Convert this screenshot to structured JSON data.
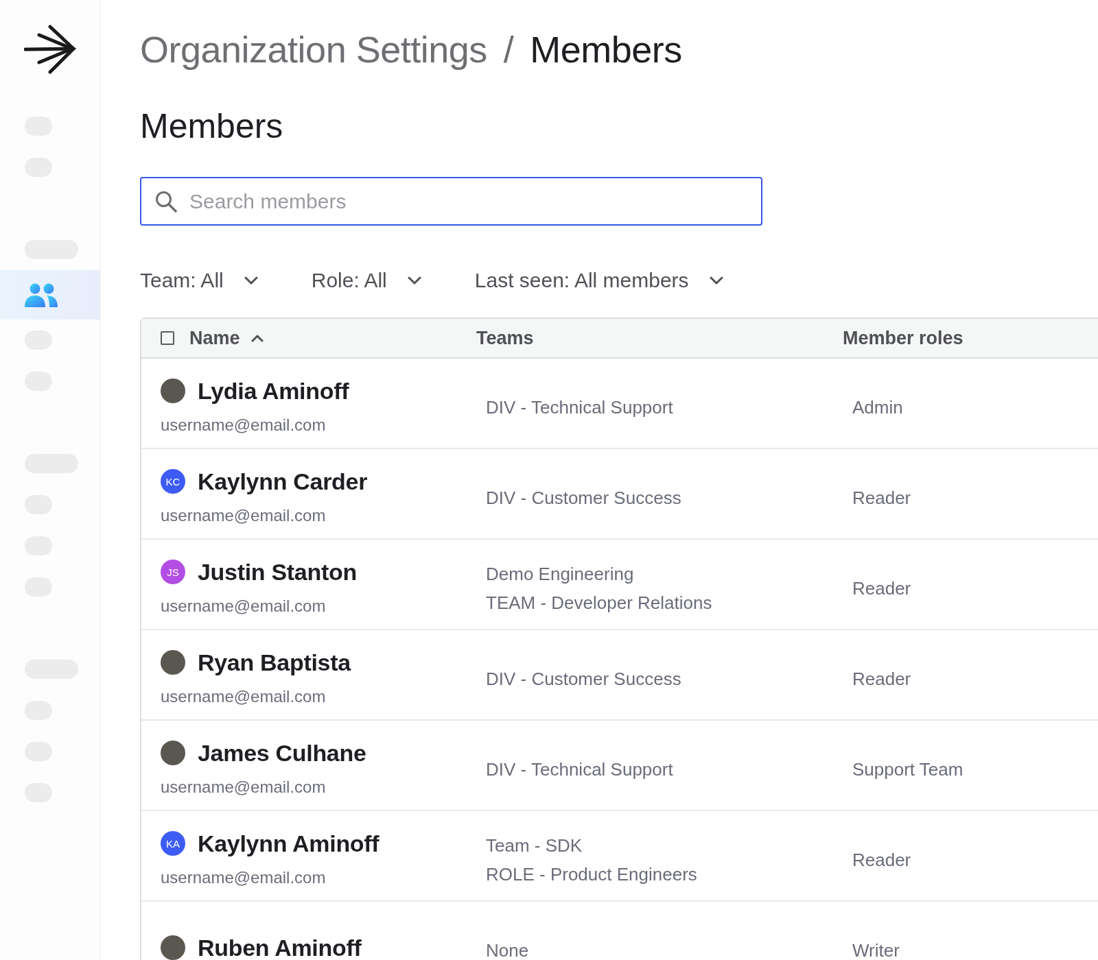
{
  "sidebar": {
    "groups": [
      [
        {
          "kind": "short",
          "selected": false
        },
        {
          "kind": "short",
          "selected": false
        }
      ],
      [
        {
          "kind": "long",
          "selected": false
        },
        {
          "kind": "people",
          "selected": true
        },
        {
          "kind": "short",
          "selected": false
        },
        {
          "kind": "short",
          "selected": false
        }
      ],
      [
        {
          "kind": "long",
          "selected": false
        },
        {
          "kind": "short",
          "selected": false
        },
        {
          "kind": "short",
          "selected": false
        },
        {
          "kind": "short",
          "selected": false
        }
      ],
      [
        {
          "kind": "long",
          "selected": false
        },
        {
          "kind": "short",
          "selected": false
        },
        {
          "kind": "short",
          "selected": false
        },
        {
          "kind": "short",
          "selected": false
        }
      ]
    ]
  },
  "breadcrumb": {
    "items": [
      {
        "label": "Organization Settings",
        "current": false
      },
      {
        "label": "Members",
        "current": true
      }
    ],
    "separator": "/"
  },
  "heading": "Members",
  "search": {
    "placeholder": "Search members"
  },
  "filters": [
    {
      "label": "Team: All"
    },
    {
      "label": "Role: All"
    },
    {
      "label": "Last seen: All members"
    }
  ],
  "table": {
    "select_all": {
      "checked": false
    },
    "columns": [
      {
        "label": "Name",
        "sorted_ascending": true
      },
      {
        "label": "Teams"
      },
      {
        "label": "Member roles"
      }
    ],
    "rows": [
      {
        "name": "Lydia Aminoff",
        "email": "username@email.com",
        "avatar": {
          "kind": "photo"
        },
        "teams": [
          "DIV - Technical Support"
        ],
        "role": "Admin"
      },
      {
        "name": "Kaylynn Carder",
        "email": "username@email.com",
        "avatar": {
          "kind": "initials",
          "initials": "KC",
          "color": "#3d5cf5"
        },
        "teams": [
          "DIV - Customer Success"
        ],
        "role": "Reader"
      },
      {
        "name": "Justin Stanton",
        "email": "username@email.com",
        "avatar": {
          "kind": "initials",
          "initials": "JS",
          "color": "#b24ee3"
        },
        "teams": [
          "Demo Engineering",
          "TEAM - Developer Relations"
        ],
        "role": "Reader"
      },
      {
        "name": "Ryan Baptista",
        "email": "username@email.com",
        "avatar": {
          "kind": "photo"
        },
        "teams": [
          "DIV - Customer Success"
        ],
        "role": "Reader"
      },
      {
        "name": "James Culhane",
        "email": "username@email.com",
        "avatar": {
          "kind": "photo"
        },
        "teams": [
          "DIV - Technical Support"
        ],
        "role": "Support Team"
      },
      {
        "name": "Kaylynn Aminoff",
        "email": "username@email.com",
        "avatar": {
          "kind": "initials",
          "initials": "KA",
          "color": "#3d5cf5"
        },
        "teams": [
          "Team - SDK",
          "ROLE - Product Engineers"
        ],
        "role": "Reader"
      },
      {
        "name": "Ruben Aminoff",
        "avatar": {
          "kind": "photo"
        },
        "teams": [
          "None"
        ],
        "role": "Writer"
      }
    ]
  }
}
